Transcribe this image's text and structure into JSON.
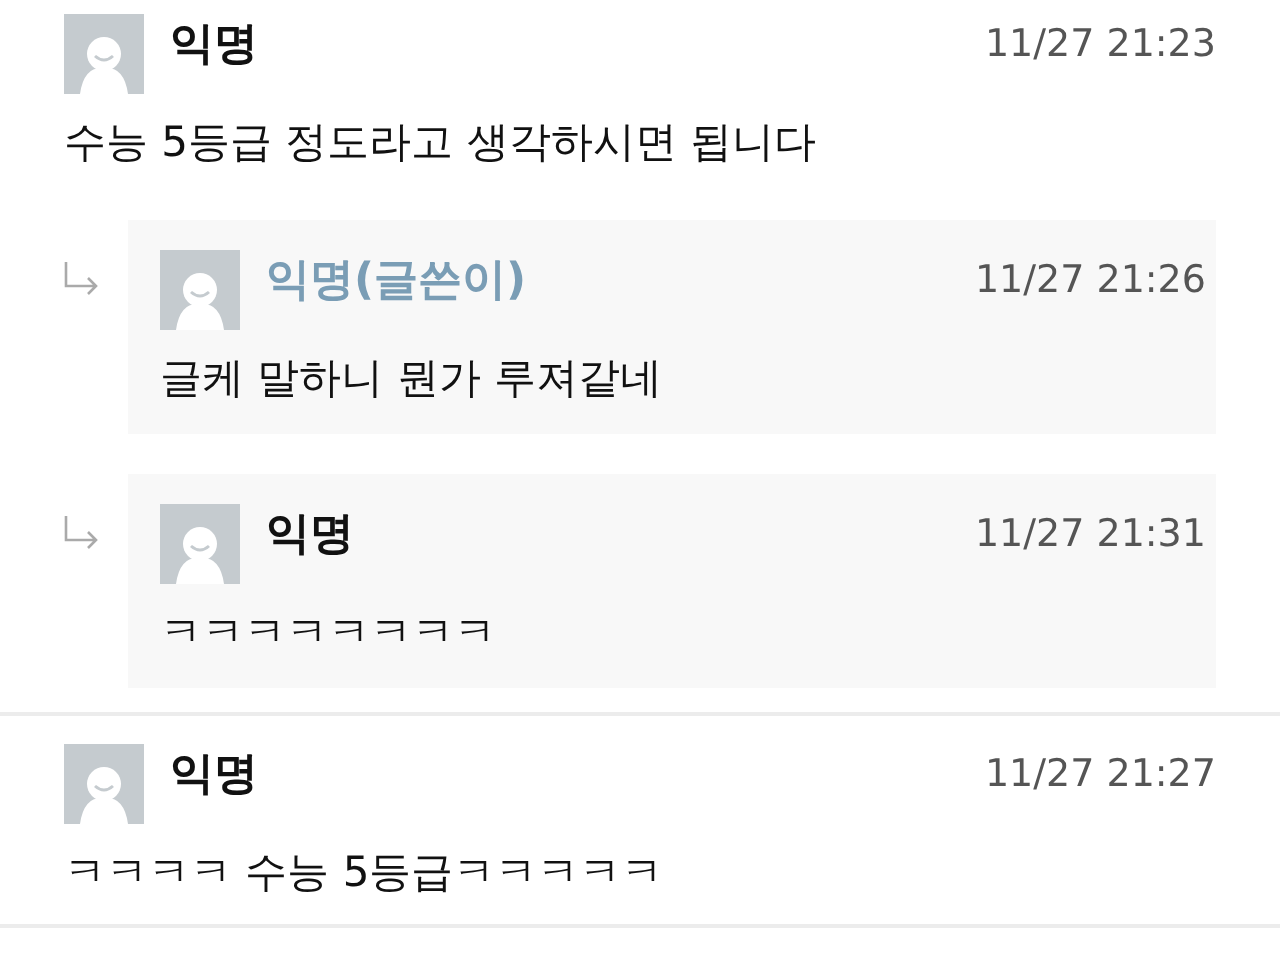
{
  "comments": [
    {
      "author": "익명",
      "is_writer": false,
      "time": "11/27 21:23",
      "text": "수능 5등급 정도라고 생각하시면 됩니다",
      "replies": [
        {
          "author": "익명(글쓴이)",
          "is_writer": true,
          "time": "11/27 21:26",
          "text": "글케 말하니 뭔가 루져같네"
        },
        {
          "author": "익명",
          "is_writer": false,
          "time": "11/27 21:31",
          "text": "ㅋㅋㅋㅋㅋㅋㅋㅋ"
        }
      ]
    },
    {
      "author": "익명",
      "is_writer": false,
      "time": "11/27 21:27",
      "text": "ㅋㅋㅋㅋ 수능 5등급ㅋㅋㅋㅋㅋ"
    }
  ]
}
